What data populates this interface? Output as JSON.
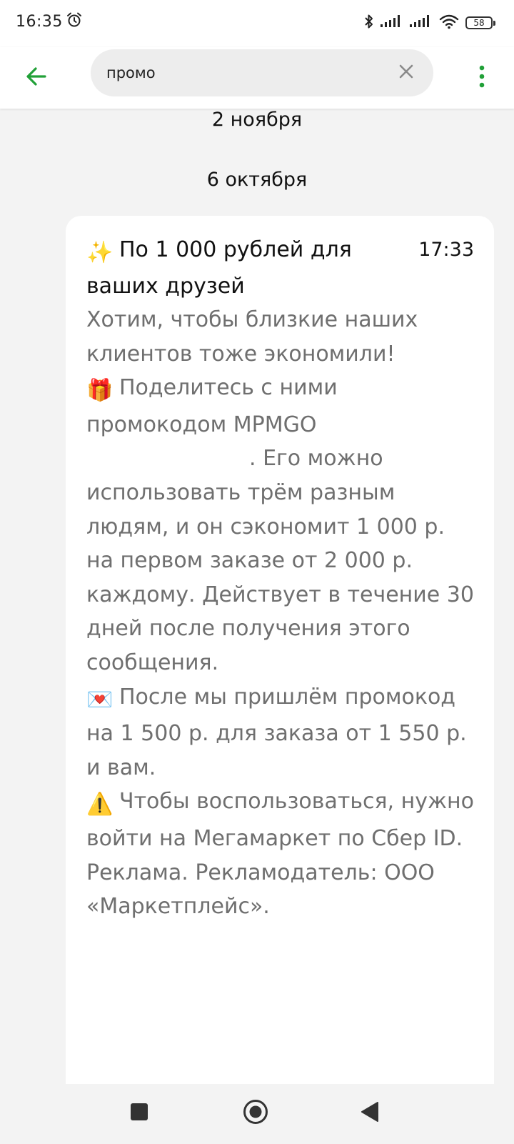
{
  "status_bar": {
    "time": "16:35",
    "battery": "58",
    "icons": [
      "alarm-icon",
      "bluetooth-icon",
      "signal-icon",
      "signal-icon",
      "wifi-icon",
      "battery-icon"
    ]
  },
  "app_bar": {
    "search_value": "промо",
    "icons": [
      "back-arrow-icon",
      "clear-icon",
      "more-vert-icon"
    ],
    "accent_color": "#21a038"
  },
  "chat": {
    "date_separators": [
      "2 ноября",
      "6 октября"
    ],
    "message": {
      "title_emoji": "✨",
      "title": "По 1 000 рублей для ваших друзей",
      "time": "17:33",
      "intro": "Хотим, чтобы близкие наших клиентов тоже экономили!",
      "gift_emoji": "🎁",
      "share_line_1": "Поделитесь с ними промокодом",
      "promo_code": "MPMGO",
      "share_line_2": ". Его можно использовать трём разным людям, и он сэкономит 1 000 р. на первом заказе от 2 000 р. каждому. Действует в течение 30 дней после получения этого сообщения.",
      "letter_emoji": "💌",
      "after_text": "После мы пришлём промокод на 1 500 р. для заказа от 1 550 р. и вам.",
      "warning_emoji": "⚠️",
      "warning_text": "Чтобы воспользоваться, нужно войти на Мегамаркет по Сбер ID. Реклама. Рекламодатель: ООО «Маркетплейс»."
    }
  },
  "nav_bar": {
    "icons": [
      "recent-apps-icon",
      "home-icon",
      "back-icon"
    ]
  }
}
